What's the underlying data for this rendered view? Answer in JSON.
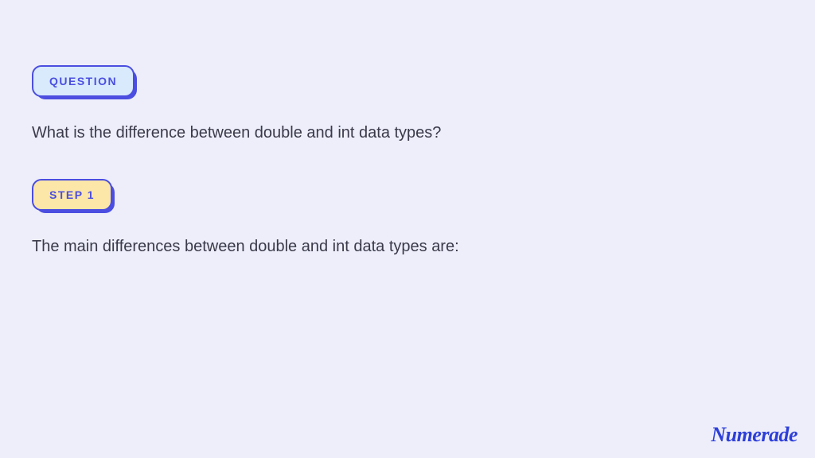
{
  "badges": {
    "question": "QUESTION",
    "step": "STEP 1"
  },
  "question_text": "What is the difference between double and int data types?",
  "step_text": "The main differences between double and int data types are:",
  "logo_text": "Numerade"
}
